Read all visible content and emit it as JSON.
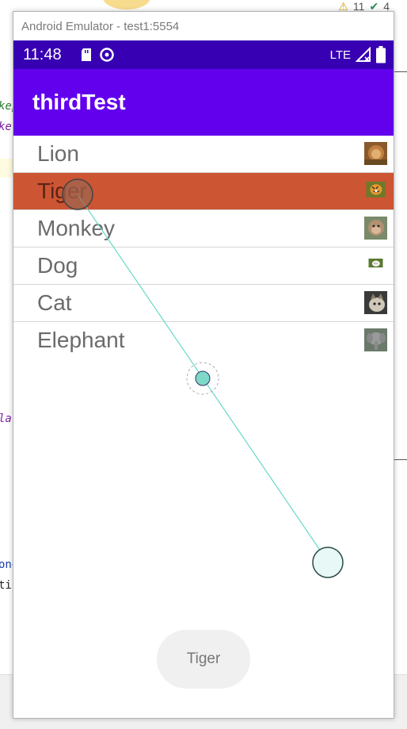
{
  "ide": {
    "warnings_count": "11",
    "checks_count": "4",
    "code_fragments": [
      "kep",
      "ke",
      "la",
      "ong",
      "ti"
    ]
  },
  "emulator": {
    "window_title": "Android Emulator - test1:5554"
  },
  "status_bar": {
    "time": "11:48",
    "network": "LTE",
    "color": "#3700b3"
  },
  "app_bar": {
    "title": "thirdTest",
    "color": "#6200ee"
  },
  "list": {
    "items": [
      {
        "label": "Lion",
        "icon": "lion-thumbnail",
        "selected": false
      },
      {
        "label": "Tiger",
        "icon": "tiger-thumbnail",
        "selected": true
      },
      {
        "label": "Monkey",
        "icon": "monkey-thumbnail",
        "selected": false
      },
      {
        "label": "Dog",
        "icon": "dog-thumbnail",
        "selected": false
      },
      {
        "label": "Cat",
        "icon": "cat-thumbnail",
        "selected": false
      },
      {
        "label": "Elephant",
        "icon": "elephant-thumbnail",
        "selected": false
      }
    ],
    "selected_color": "#cc5533"
  },
  "toast": {
    "text": "Tiger"
  }
}
